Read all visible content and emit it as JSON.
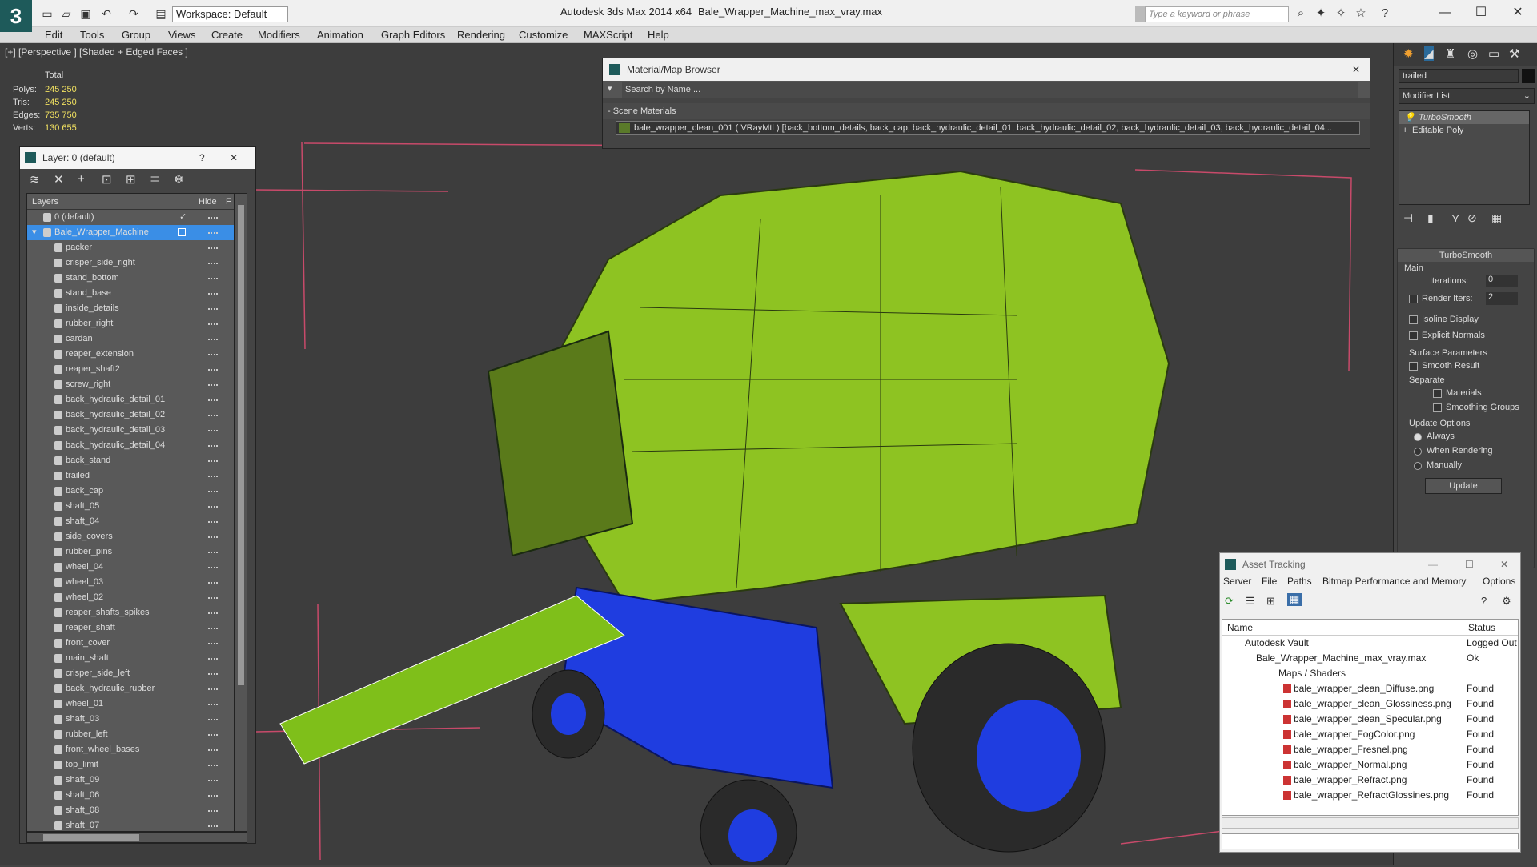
{
  "titlebar": {
    "logo": "3",
    "workspace": "Workspace: Default",
    "app_title": "Autodesk 3ds Max  2014 x64",
    "file_title": "Bale_Wrapper_Machine_max_vray.max",
    "search_placeholder": "Type a keyword or phrase",
    "minimize": "—",
    "maximize": "☐",
    "close": "✕"
  },
  "menu": [
    "Edit",
    "Tools",
    "Group",
    "Views",
    "Create",
    "Modifiers",
    "Animation",
    "Graph Editors",
    "Rendering",
    "Customize",
    "MAXScript",
    "Help"
  ],
  "viewport": {
    "label": "[+] [Perspective ] [Shaded + Edged Faces ]",
    "stats": {
      "total_label": "Total",
      "rows": [
        {
          "label": "Polys:",
          "value": "245 250"
        },
        {
          "label": "Tris:",
          "value": "245 250"
        },
        {
          "label": "Edges:",
          "value": "735 750"
        },
        {
          "label": "Verts:",
          "value": "130 655"
        }
      ]
    }
  },
  "layer_panel": {
    "title": "Layer: 0 (default)",
    "help": "?",
    "close": "✕",
    "col_layers": "Layers",
    "col_hide": "Hide",
    "col_f": "F",
    "default_layer": "0 (default)",
    "selected_layer": "Bale_Wrapper_Machine",
    "items": [
      "packer",
      "crisper_side_right",
      "stand_bottom",
      "stand_base",
      "inside_details",
      "rubber_right",
      "cardan",
      "reaper_extension",
      "reaper_shaft2",
      "screw_right",
      "back_hydraulic_detail_01",
      "back_hydraulic_detail_02",
      "back_hydraulic_detail_03",
      "back_hydraulic_detail_04",
      "back_stand",
      "trailed",
      "back_cap",
      "shaft_05",
      "shaft_04",
      "side_covers",
      "rubber_pins",
      "wheel_04",
      "wheel_03",
      "wheel_02",
      "reaper_shafts_spikes",
      "reaper_shaft",
      "front_cover",
      "main_shaft",
      "crisper_side_left",
      "back_hydraulic_rubber",
      "wheel_01",
      "shaft_03",
      "rubber_left",
      "front_wheel_bases",
      "top_limit",
      "shaft_09",
      "shaft_06",
      "shaft_08",
      "shaft_07"
    ]
  },
  "material_browser": {
    "title": "Material/Map Browser",
    "close": "✕",
    "search": "Search by Name ...",
    "group": "- Scene Materials",
    "material": "bale_wrapper_clean_001 ( VRayMtl ) [back_bottom_details, back_cap, back_hydraulic_detail_01, back_hydraulic_detail_02, back_hydraulic_detail_03, back_hydraulic_detail_04..."
  },
  "command_panel": {
    "object_name": "trailed",
    "modifier_list": "Modifier List",
    "stack": [
      "TurboSmooth",
      "Editable Poly"
    ],
    "rollout_title": "TurboSmooth",
    "main_label": "Main",
    "iterations_label": "Iterations:",
    "iterations_value": "0",
    "render_iters_label": "Render Iters:",
    "render_iters_value": "2",
    "isoline": "Isoline Display",
    "explicit": "Explicit Normals",
    "surface_params": "Surface Parameters",
    "smooth_result": "Smooth Result",
    "separate": "Separate",
    "materials": "Materials",
    "smoothing_groups": "Smoothing Groups",
    "update_options": "Update Options",
    "always": "Always",
    "when_rendering": "When Rendering",
    "manually": "Manually",
    "update": "Update"
  },
  "asset_tracking": {
    "title": "Asset Tracking",
    "minimize": "—",
    "maximize": "☐",
    "close": "✕",
    "menu": [
      "Server",
      "File",
      "Paths",
      "Bitmap Performance and Memory",
      "Options"
    ],
    "col_name": "Name",
    "col_status": "Status",
    "vault": {
      "name": "Autodesk Vault",
      "status": "Logged Out"
    },
    "file": {
      "name": "Bale_Wrapper_Machine_max_vray.max",
      "status": "Ok"
    },
    "maps_group": "Maps / Shaders",
    "maps": [
      {
        "name": "bale_wrapper_clean_Diffuse.png",
        "status": "Found"
      },
      {
        "name": "bale_wrapper_clean_Glossiness.png",
        "status": "Found"
      },
      {
        "name": "bale_wrapper_clean_Specular.png",
        "status": "Found"
      },
      {
        "name": "bale_wrapper_FogColor.png",
        "status": "Found"
      },
      {
        "name": "bale_wrapper_Fresnel.png",
        "status": "Found"
      },
      {
        "name": "bale_wrapper_Normal.png",
        "status": "Found"
      },
      {
        "name": "bale_wrapper_Refract.png",
        "status": "Found"
      },
      {
        "name": "bale_wrapper_RefractGlossines.png",
        "status": "Found"
      }
    ]
  }
}
